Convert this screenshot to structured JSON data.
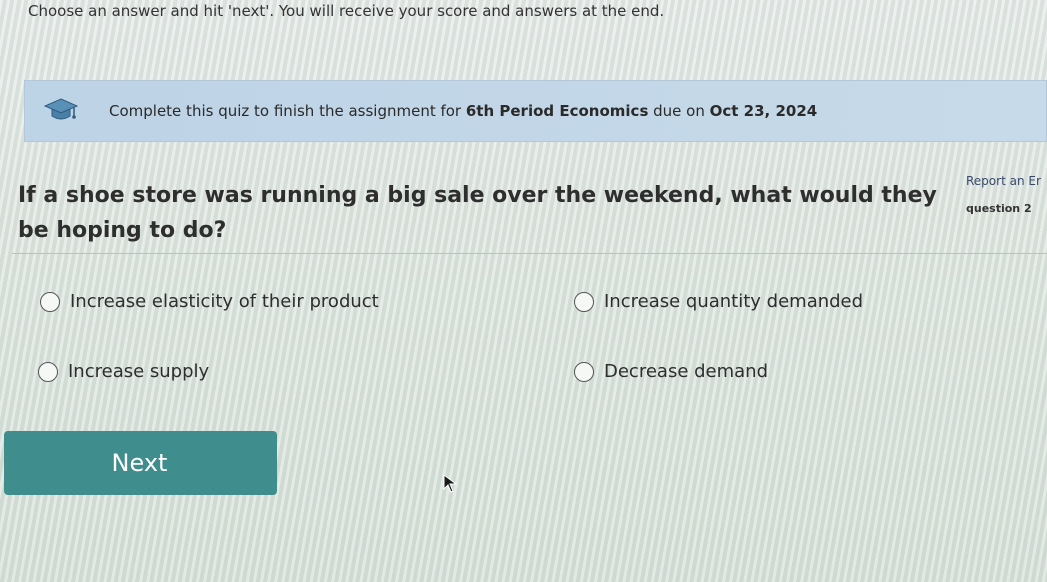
{
  "instructions": "Choose an answer and hit 'next'. You will receive your score and answers at the end.",
  "banner": {
    "icon": "graduation-cap-icon",
    "text_before": "Complete this quiz to finish the assignment for ",
    "course": "6th Period Economics",
    "text_middle": " due on ",
    "due_date": "Oct 23, 2024"
  },
  "question": {
    "text": "If a shoe store was running a big sale over the weekend, what would they be hoping to do?",
    "report_link": "Report an Er",
    "number_label": "question 2 "
  },
  "options": [
    {
      "label": "Increase elasticity of their product"
    },
    {
      "label": "Increase quantity demanded"
    },
    {
      "label": "Increase supply"
    },
    {
      "label": "Decrease demand"
    }
  ],
  "next_label": "Next",
  "colors": {
    "banner": "#c2d6e8",
    "next_button": "#3f8d8c"
  }
}
